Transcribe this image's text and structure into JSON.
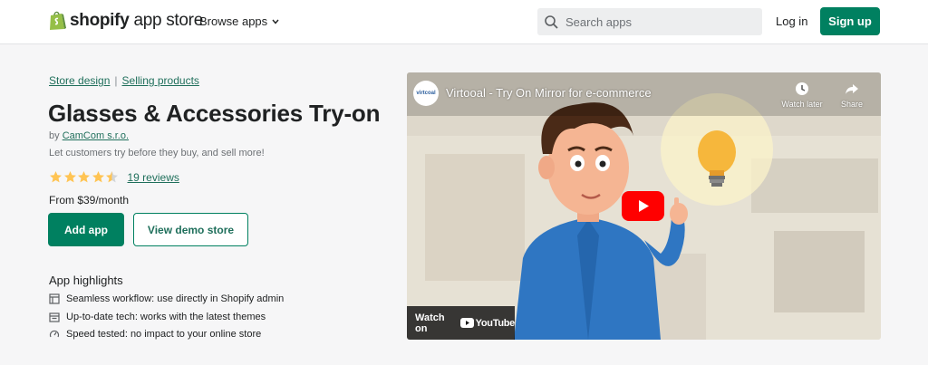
{
  "header": {
    "logo_bold": "shopify",
    "logo_light": " app store",
    "browse_label": "Browse apps",
    "search_placeholder": "Search apps",
    "login_label": "Log in",
    "signup_label": "Sign up"
  },
  "breadcrumbs": [
    "Store design",
    "Selling products"
  ],
  "app": {
    "title": "Glasses & Accessories Try-on",
    "by_prefix": "by ",
    "developer": "CamCom s.r.o.",
    "tagline": "Let customers try before they buy, and sell more!",
    "rating": 4.5,
    "reviews_label": "19 reviews",
    "price": "From $39/month",
    "add_label": "Add app",
    "demo_label": "View demo store"
  },
  "highlights": {
    "title": "App highlights",
    "items": [
      {
        "icon": "workflow-icon",
        "text": "Seamless workflow: use directly in Shopify admin"
      },
      {
        "icon": "calendar-icon",
        "text": "Up-to-date tech: works with the latest themes"
      },
      {
        "icon": "speed-icon",
        "text": "Speed tested: no impact to your online store"
      }
    ]
  },
  "video": {
    "channel_label": "virtcoal",
    "title": "Virtooal - Try On Mirror for e-commerce",
    "watch_later": "Watch later",
    "share": "Share",
    "watch_on": "Watch on",
    "youtube": "YouTube"
  },
  "colors": {
    "brand_green": "#008060",
    "link_green": "#1f6f5b",
    "star": "#ffc453",
    "youtube_red": "#ff0000"
  }
}
